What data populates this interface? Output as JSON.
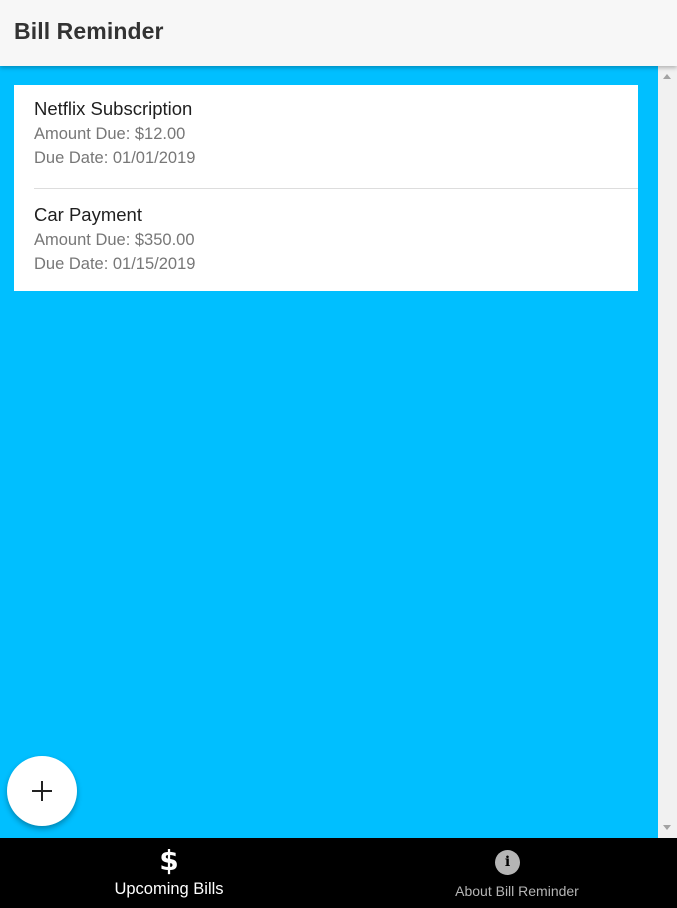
{
  "app": {
    "title": "Bill Reminder"
  },
  "bills": [
    {
      "name": "Netflix Subscription",
      "amount": "Amount Due: $12.00",
      "due_date": "Due Date: 01/01/2019"
    },
    {
      "name": "Car Payment",
      "amount": "Amount Due: $350.00",
      "due_date": "Due Date: 01/15/2019"
    }
  ],
  "fab": {
    "icon": "plus-icon",
    "glyph": ""
  },
  "bottom_nav": {
    "tabs": [
      {
        "label": "Upcoming Bills",
        "icon": "dollar-icon",
        "glyph": "$",
        "active": true
      },
      {
        "label": "About Bill Reminder",
        "icon": "info-icon",
        "glyph": "i",
        "active": false
      }
    ]
  },
  "colors": {
    "background": "#00bfff",
    "app_bar": "#f7f7f7",
    "card": "#ffffff",
    "bottom_nav": "#000000",
    "nav_active": "#ffffff",
    "nav_inactive": "#b5b5b5"
  }
}
